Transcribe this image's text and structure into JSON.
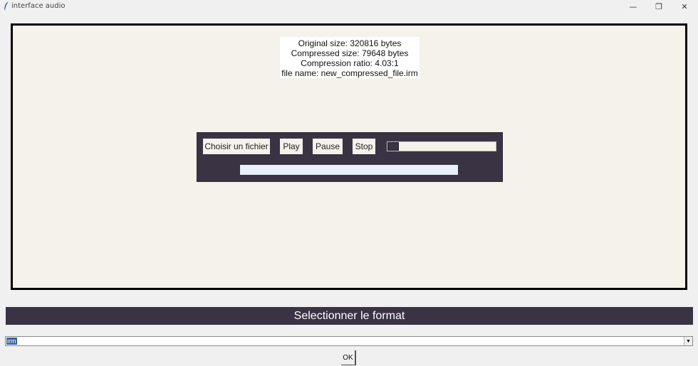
{
  "window": {
    "title": "interface audio",
    "minimize_symbol": "—",
    "maximize_symbol": "❐",
    "close_symbol": "✕",
    "icon": "feather-icon"
  },
  "info": {
    "original_size": "Original size: 320816 bytes",
    "compressed_size": "Compressed size: 79648 bytes",
    "compression_ratio": "Compression ratio: 4.03:1",
    "file_name": "file name: new_compressed_file.irm"
  },
  "player": {
    "choose_file_label": "Choisir un fichier",
    "play_label": "Play",
    "pause_label": "Pause",
    "stop_label": "Stop",
    "volume_slider_value": 0,
    "progress_value": 0
  },
  "format": {
    "header_label": "Selectionner le format",
    "selected_value": "irm",
    "dropdown_icon": "triangle-down-icon",
    "ok_label": "OK"
  },
  "colors": {
    "panel_dark": "#393344",
    "frame_bg": "#f5f1eb",
    "selection": "#3a5f9c"
  }
}
